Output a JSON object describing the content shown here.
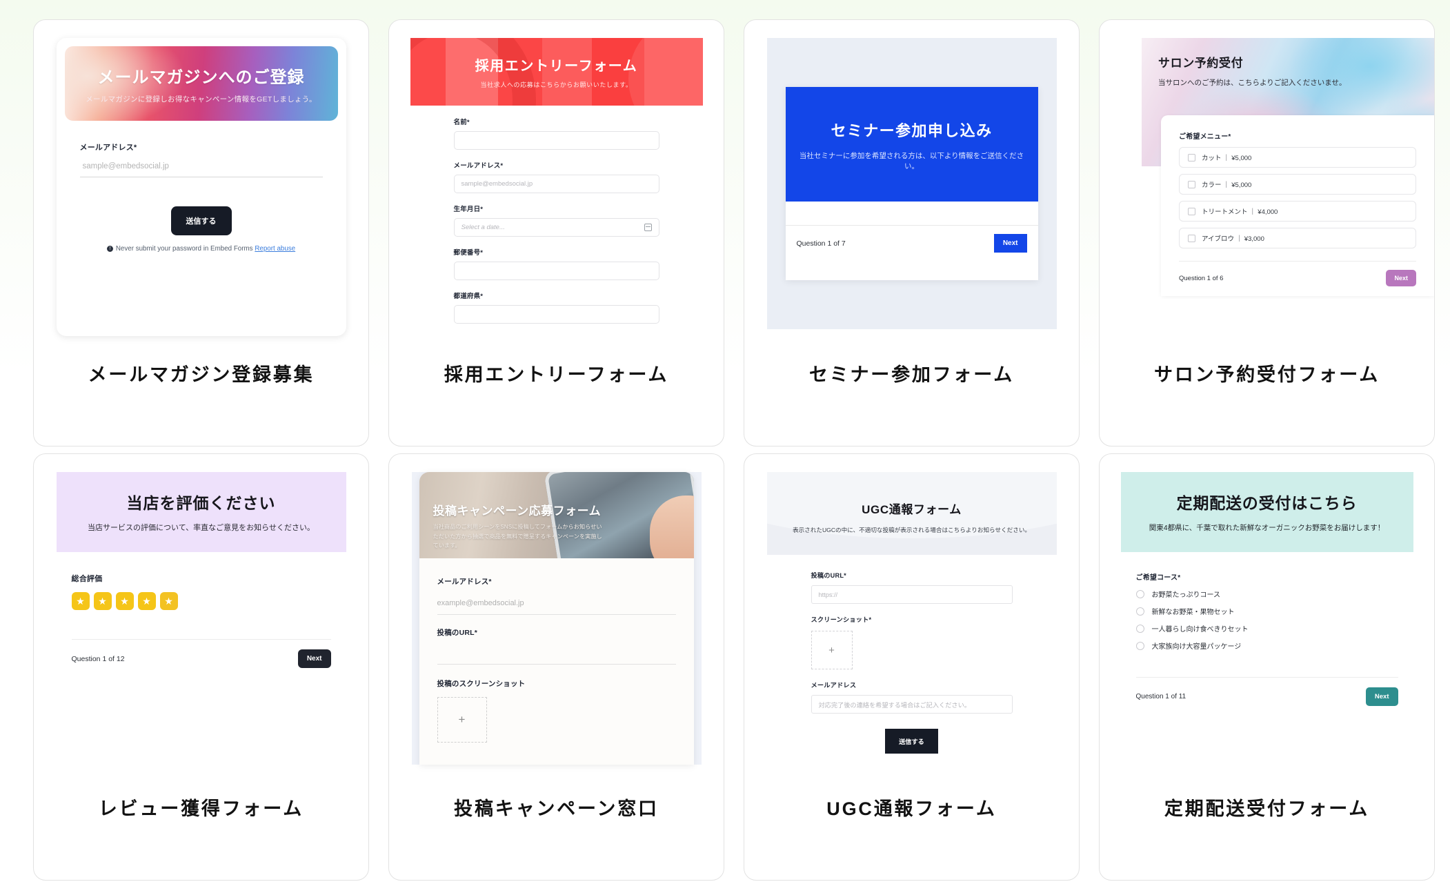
{
  "page": {
    "background": "#f6fbf2",
    "card_border": "#e2e2e2"
  },
  "cards": [
    {
      "title": "メールマガジン登録募集",
      "preview": {
        "hero_title": "メールマガジンへのご登録",
        "hero_subtitle": "メールマガジンに登録しお得なキャンペーン情報をGETしましょう。",
        "field_label": "メールアドレス*",
        "field_placeholder": "sample@embedsocial.jp",
        "submit_label": "送信する",
        "footer_note": "Never submit your password in Embed Forms",
        "footer_link": "Report abuse",
        "footer_icon": "info-icon",
        "accent": "#161b26"
      }
    },
    {
      "title": "採用エントリーフォーム",
      "preview": {
        "hero_title": "採用エントリーフォーム",
        "hero_subtitle": "当社求人への応募はこちらからお願いいたします。",
        "accent": "#fc4a4a",
        "fields": [
          {
            "label": "名前*",
            "placeholder": ""
          },
          {
            "label": "メールアドレス*",
            "placeholder": "sample@embedsocial.jp"
          },
          {
            "label": "生年月日*",
            "placeholder": "Select a date...",
            "icon": "calendar-icon"
          },
          {
            "label": "郵便番号*",
            "placeholder": ""
          },
          {
            "label": "都道府県*",
            "placeholder": ""
          }
        ]
      }
    },
    {
      "title": "セミナー参加フォーム",
      "preview": {
        "hero_title": "セミナー参加申し込み",
        "hero_subtitle": "当社セミナーに参加を希望される方は、以下より情報をご送信ください。",
        "question_progress": "Question 1 of 7",
        "next_label": "Next",
        "accent": "#1346e8",
        "stage_bg": "#eaeef5"
      }
    },
    {
      "title": "サロン予約受付フォーム",
      "preview": {
        "hero_title": "サロン予約受付",
        "hero_subtitle": "当サロンへのご予約は、こちらよりご記入くださいませ。",
        "field_label": "ご希望メニュー*",
        "options": [
          "カット ｜ ¥5,000",
          "カラー ｜ ¥5,000",
          "トリートメント ｜ ¥4,000",
          "アイブロウ ｜ ¥3,000"
        ],
        "question_progress": "Question 1 of 6",
        "next_label": "Next",
        "accent": "#b877bd"
      }
    },
    {
      "title": "レビュー獲得フォーム",
      "preview": {
        "hero_title": "当店を評価ください",
        "hero_subtitle": "当店サービスの評価について、率直なご意見をお知らせください。",
        "hero_bg": "#eee1fb",
        "field_label": "総合評価",
        "star_count": 5,
        "star_color": "#f5c518",
        "star_glyph": "★",
        "question_progress": "Question 1 of 12",
        "next_label": "Next",
        "accent": "#20242e"
      }
    },
    {
      "title": "投稿キャンペーン窓口",
      "preview": {
        "hero_title": "投稿キャンペーン応募フォーム",
        "hero_subtitle": "当社商品のご利用シーンをSNSに投稿してフォームからお知らせいただいた方から抽選で商品を無料で贈呈するキャンペーンを実施しています。",
        "fields": [
          {
            "label": "メールアドレス*",
            "placeholder": "example@embedsocial.jp"
          },
          {
            "label": "投稿のURL*",
            "placeholder": ""
          }
        ],
        "upload_label": "投稿のスクリーンショット",
        "upload_glyph": "+",
        "stage_bg": "#eef1f8"
      }
    },
    {
      "title": "UGC通報フォーム",
      "preview": {
        "hero_title": "UGC通報フォーム",
        "hero_subtitle": "表示されたUGCの中に、不適切な投稿が表示される場合はこちらよりお知らせください。",
        "fields": [
          {
            "label": "投稿のURL*",
            "placeholder": "https://"
          }
        ],
        "upload_label": "スクリーンショット*",
        "upload_glyph": "+",
        "email_label": "メールアドレス",
        "email_placeholder": "対応完了後の連絡を希望する場合はご記入ください。",
        "submit_label": "送信する",
        "accent": "#161b26"
      }
    },
    {
      "title": "定期配送受付フォーム",
      "preview": {
        "hero_title": "定期配送の受付はこちら",
        "hero_subtitle": "関東4都県に、千葉で取れた新鮮なオーガニックお野菜をお届けします！",
        "hero_bg": "#cfeeea",
        "field_label": "ご希望コース*",
        "options": [
          "お野菜たっぷりコース",
          "新鮮なお野菜・果物セット",
          "一人暮らし向け食べきりセット",
          "大家族向け大容量パッケージ"
        ],
        "question_progress": "Question 1 of 11",
        "next_label": "Next",
        "accent": "#2d8e8e"
      }
    }
  ]
}
